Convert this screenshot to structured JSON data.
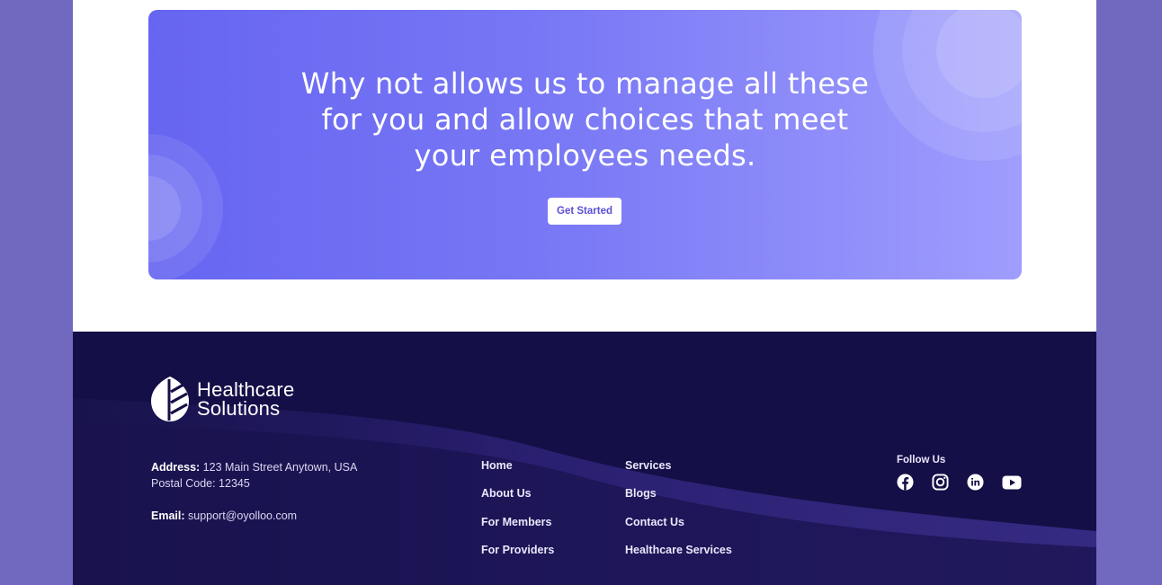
{
  "cta": {
    "title": "Why not allows us to manage all these for you and allow choices that meet your employees needs.",
    "button_label": "Get Started"
  },
  "brand": {
    "line1": "Healthcare",
    "line2": "Solutions"
  },
  "contact": {
    "address_label": "Address:",
    "address_value": "123 Main Street Anytown, USA",
    "postal": "Postal Code: 12345",
    "email_label": "Email:",
    "email_value": "support@oyolloo.com"
  },
  "nav": {
    "col1": [
      "Home",
      "About Us",
      "For Members",
      "For Providers"
    ],
    "col2": [
      "Services",
      "Blogs",
      "Contact Us",
      "Healthcare Services"
    ]
  },
  "social": {
    "heading": "Follow Us",
    "icons": [
      "facebook-icon",
      "instagram-icon",
      "linkedin-icon",
      "youtube-icon"
    ]
  },
  "colors": {
    "cta_gradient_start": "#6665f1",
    "cta_gradient_end": "#9f9dfd",
    "footer_bg": "#140f47",
    "side_bg": "#7069bf",
    "button_text": "#5b4fd6"
  }
}
